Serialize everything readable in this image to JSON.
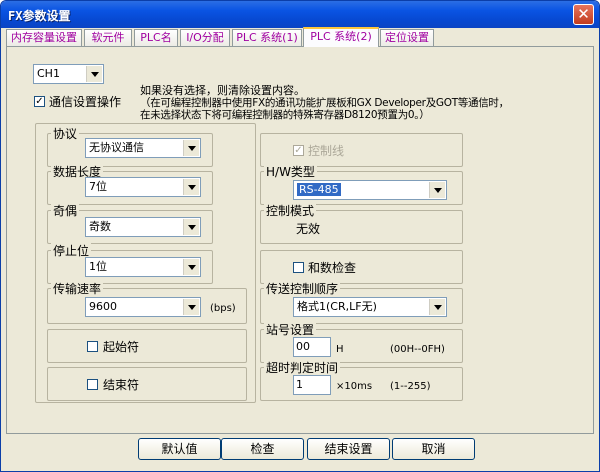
{
  "window": {
    "title": "FX参数设置",
    "close_glyph": "✕"
  },
  "tabs": [
    {
      "label": "内存容量设置"
    },
    {
      "label": "软元件"
    },
    {
      "label": "PLC名"
    },
    {
      "label": "I/O分配"
    },
    {
      "label": "PLC 系统(1)"
    },
    {
      "label": "PLC 系统(2)",
      "active": true
    },
    {
      "label": "定位设置"
    }
  ],
  "channel": {
    "value": "CH1"
  },
  "comm_setup": {
    "label": "通信设置操作",
    "checked": true,
    "check_glyph": "✓"
  },
  "note": [
    "如果没有选择，则清除设置内容。",
    "（在可编程控制器中使用FX的通讯功能扩展板和GX Developer及GOT等通信时，",
    "在未选择状态下将可编程控制器的特殊寄存器D8120预置为0。）"
  ],
  "protocol": {
    "label": "协议",
    "value": "无协议通信"
  },
  "data_length": {
    "label": "数据长度",
    "value": "7位"
  },
  "parity": {
    "label": "奇偶",
    "value": "奇数"
  },
  "stop_bit": {
    "label": "停止位",
    "value": "1位"
  },
  "baud_rate": {
    "label": "传输速率",
    "value": "9600",
    "unit": "(bps)"
  },
  "start_char": {
    "label": "起始符",
    "checked": false
  },
  "end_char": {
    "label": "结束符",
    "checked": false
  },
  "control_line": {
    "label": "控制线",
    "checked": true,
    "check_glyph": "✓",
    "disabled": true
  },
  "hw_type": {
    "label": "H/W类型",
    "value": "RS-485"
  },
  "control_mode": {
    "label": "控制模式",
    "value": "无效"
  },
  "sum_check": {
    "label": "和数检查",
    "checked": false
  },
  "transfer_seq": {
    "label": "传送控制顺序",
    "value": "格式1(CR,LF无)"
  },
  "station_no": {
    "label": "站号设置",
    "value": "00",
    "unit": "H",
    "range": "(00H--0FH)"
  },
  "timeout": {
    "label": "超时判定时间",
    "value": "1",
    "unit": "×10ms",
    "range": "(1--255)"
  },
  "buttons": {
    "default": "默认值",
    "check": "检查",
    "finish": "结束设置",
    "cancel": "取消"
  }
}
